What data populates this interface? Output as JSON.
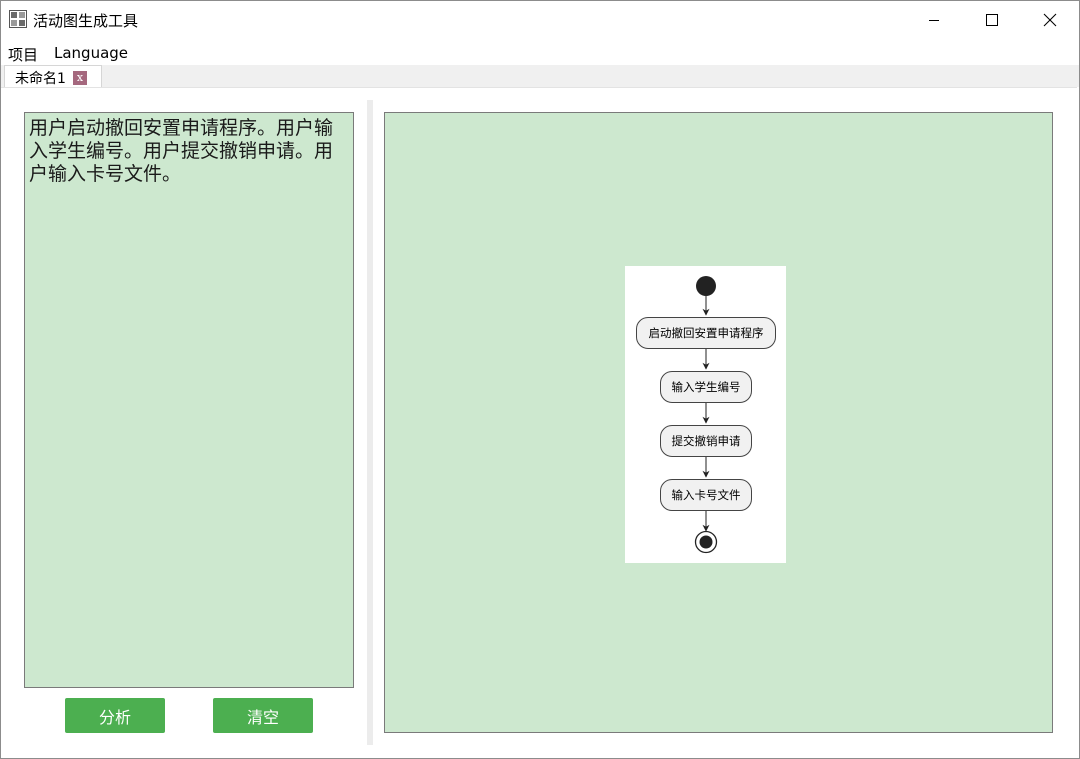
{
  "window": {
    "title": "活动图生成工具",
    "app_icon": "app-icon",
    "controls": {
      "minimize": "minimize-icon",
      "maximize": "maximize-icon",
      "close": "close-icon"
    }
  },
  "menu": {
    "items": [
      {
        "label": "项目"
      },
      {
        "label": "Language"
      }
    ]
  },
  "tabs": [
    {
      "label": "未命名1",
      "close_label": "x",
      "active": true
    }
  ],
  "editor": {
    "text": "用户启动撤回安置申请程序。用户输入学生编号。用户提交撤销申请。用户输入卡号文件。"
  },
  "buttons": {
    "analyze": "分析",
    "clear": "清空"
  },
  "diagram": {
    "type": "activity",
    "start_node": "start-node",
    "end_node": "end-node",
    "actions": [
      {
        "label": "启动撤回安置申请程序"
      },
      {
        "label": "输入学生编号"
      },
      {
        "label": "提交撤销申请"
      },
      {
        "label": "输入卡号文件"
      }
    ]
  },
  "colors": {
    "panel_bg": "#cde8cf",
    "button_bg": "#4caf50",
    "button_text": "#ffffff",
    "tab_close_bg": "#a5687e",
    "node_fill": "#f1f1f1",
    "node_border": "#444444",
    "dark": "#222222"
  }
}
